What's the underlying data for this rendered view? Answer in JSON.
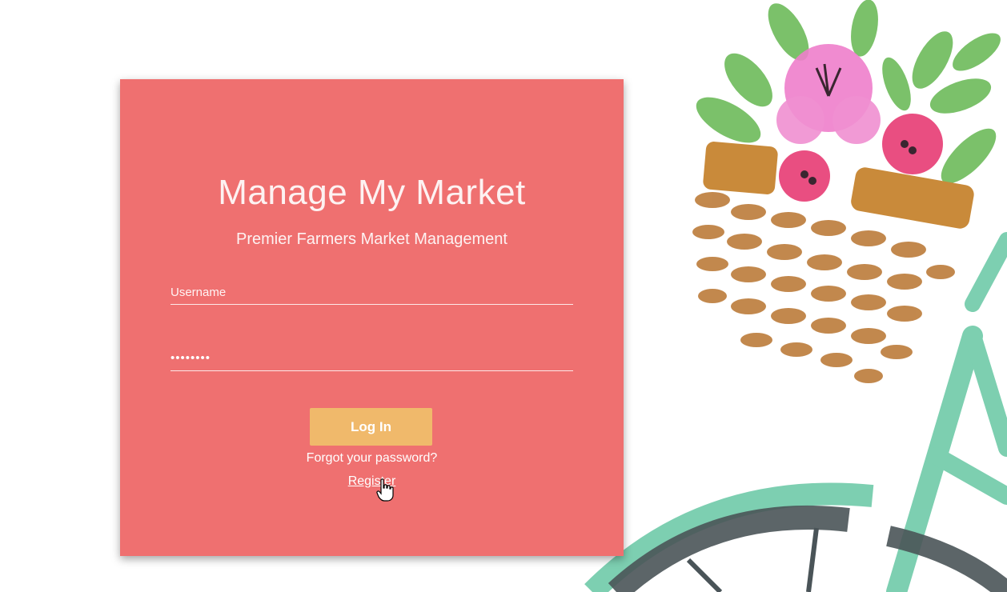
{
  "login": {
    "title": "Manage My Market",
    "subtitle": "Premier Farmers Market Management",
    "username_placeholder": "Username",
    "password_value": "••••••••",
    "login_label": "Log In",
    "forgot_label": "Forgot your password?",
    "register_label": "Register"
  },
  "colors": {
    "card": "#ef7070",
    "button": "#f0b96b",
    "text": "#ffffff"
  },
  "illustration": {
    "subject": "watercolor bicycle basket with flowers"
  }
}
